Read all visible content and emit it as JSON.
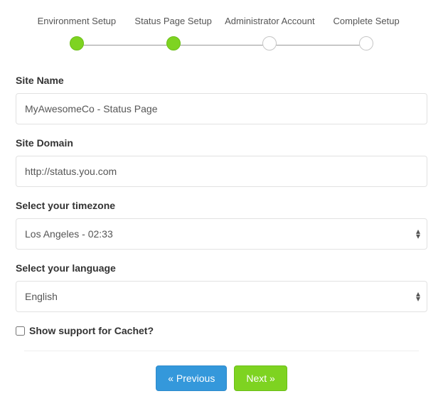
{
  "stepper": {
    "steps": [
      {
        "label": "Environment Setup",
        "state": "done"
      },
      {
        "label": "Status Page Setup",
        "state": "done"
      },
      {
        "label": "Administrator Account",
        "state": "pending"
      },
      {
        "label": "Complete Setup",
        "state": "pending"
      }
    ]
  },
  "form": {
    "site_name": {
      "label": "Site Name",
      "value": "MyAwesomeCo - Status Page"
    },
    "site_domain": {
      "label": "Site Domain",
      "value": "http://status.you.com"
    },
    "timezone": {
      "label": "Select your timezone",
      "selected": "Los Angeles - 02:33"
    },
    "language": {
      "label": "Select your language",
      "selected": "English"
    },
    "support": {
      "label": "Show support for Cachet?",
      "checked": false
    }
  },
  "buttons": {
    "previous": "« Previous",
    "next": "Next »"
  }
}
